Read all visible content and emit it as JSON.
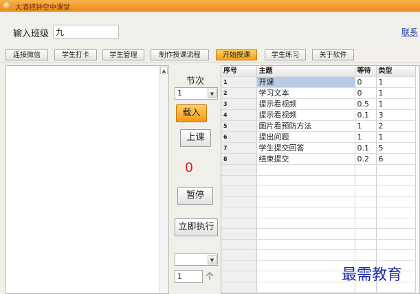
{
  "window": {
    "title": "大酒把钟空中课堂"
  },
  "class_input": {
    "label": "输入班级",
    "value": "九"
  },
  "contact_link": "联系",
  "toolbar": {
    "buttons": [
      {
        "label": "连接微信"
      },
      {
        "label": "学生打卡"
      },
      {
        "label": "学生管理"
      },
      {
        "label": "制作授课流程"
      },
      {
        "label": "开始授课",
        "active": true
      },
      {
        "label": "学生练习"
      },
      {
        "label": "关于软件"
      }
    ]
  },
  "controls": {
    "session_label": "节次",
    "session_value": "1",
    "load_label": "载入",
    "class_label": "上课",
    "counter": "0",
    "pause_label": "暂停",
    "execute_label": "立即执行",
    "count_value": "1",
    "count_unit": "个"
  },
  "table": {
    "headers": [
      "序号",
      "主题",
      "等待",
      "类型"
    ],
    "rows": [
      {
        "no": "1",
        "topic": "开课",
        "wait": "0",
        "type": "1",
        "selected": true
      },
      {
        "no": "2",
        "topic": "学习文本",
        "wait": "0",
        "type": "1"
      },
      {
        "no": "3",
        "topic": "提示看视频",
        "wait": "0.5",
        "type": "1"
      },
      {
        "no": "4",
        "topic": "提示看视频",
        "wait": "0.1",
        "type": "3"
      },
      {
        "no": "5",
        "topic": "图片看预防方法",
        "wait": "1",
        "type": "2"
      },
      {
        "no": "6",
        "topic": "提出问题",
        "wait": "1",
        "type": "1"
      },
      {
        "no": "7",
        "topic": "学生提交回答",
        "wait": "0.1",
        "type": "5"
      },
      {
        "no": "8",
        "topic": "结束提交",
        "wait": "0.2",
        "type": "6"
      }
    ]
  },
  "watermark": "最需教育"
}
